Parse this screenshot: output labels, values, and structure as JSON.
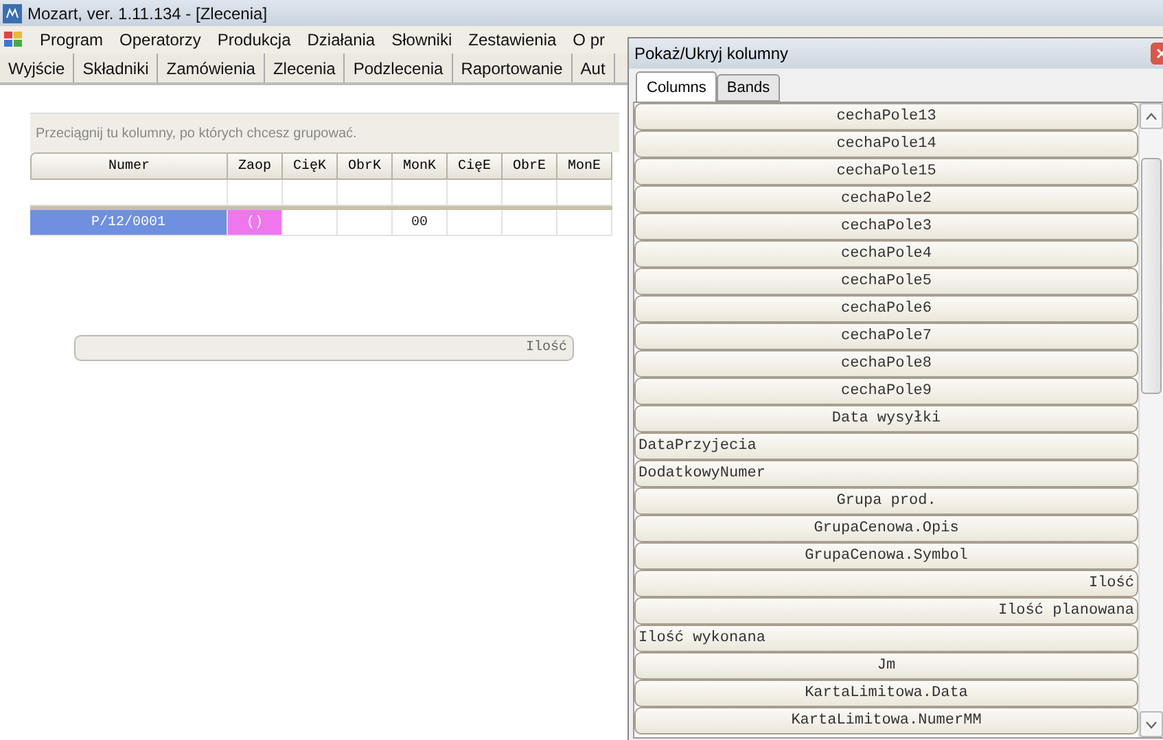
{
  "window": {
    "title": "Mozart, ver. 1.11.134 - [Zlecenia]"
  },
  "menu": [
    "Program",
    "Operatorzy",
    "Produkcja",
    "Działania",
    "Słowniki",
    "Zestawienia",
    "O pr"
  ],
  "toolbar": [
    "Wyjście",
    "Składniki",
    "Zamówienia",
    "Zlecenia",
    "Podzlecenia",
    "Raportowanie",
    "Aut"
  ],
  "grid": {
    "group_hint": "Przeciągnij tu kolumny, po których chcesz grupować.",
    "columns": [
      "Numer",
      "Zaop",
      "CięK",
      "ObrK",
      "MonK",
      "CięE",
      "ObrE",
      "MonE"
    ],
    "rows": [
      {
        "selected": true,
        "cells": [
          {
            "text": "P/12/0001",
            "color": "#6f8fe0"
          },
          {
            "text": "()",
            "color": "#ee77ee"
          },
          {
            "text": ""
          },
          {
            "text": ""
          },
          {
            "text": "00"
          },
          {
            "text": ""
          },
          {
            "text": ""
          },
          {
            "text": ""
          }
        ]
      }
    ],
    "dragged_column": "Ilość"
  },
  "dialog": {
    "title": "Pokaż/Ukryj kolumny",
    "tabs": [
      {
        "label": "Columns",
        "selected": true
      },
      {
        "label": "Bands",
        "selected": false
      }
    ],
    "columns": [
      {
        "label": "cechaPole13",
        "kind": "center"
      },
      {
        "label": "cechaPole14",
        "kind": "center"
      },
      {
        "label": "cechaPole15",
        "kind": "center"
      },
      {
        "label": "cechaPole2",
        "kind": "center"
      },
      {
        "label": "cechaPole3",
        "kind": "center"
      },
      {
        "label": "cechaPole4",
        "kind": "center"
      },
      {
        "label": "cechaPole5",
        "kind": "center"
      },
      {
        "label": "cechaPole6",
        "kind": "center"
      },
      {
        "label": "cechaPole7",
        "kind": "center"
      },
      {
        "label": "cechaPole8",
        "kind": "center"
      },
      {
        "label": "cechaPole9",
        "kind": "center"
      },
      {
        "label": "Data wysyłki",
        "kind": "center"
      },
      {
        "label": "DataPrzyjecia",
        "kind": "left"
      },
      {
        "label": "DodatkowyNumer",
        "kind": "left"
      },
      {
        "label": "Grupa prod.",
        "kind": "center"
      },
      {
        "label": "GrupaCenowa.Opis",
        "kind": "center"
      },
      {
        "label": "GrupaCenowa.Symbol",
        "kind": "center"
      },
      {
        "label": "Ilość",
        "kind": "right"
      },
      {
        "label": "Ilość planowana",
        "kind": "right"
      },
      {
        "label": "Ilość wykonana",
        "kind": "left"
      },
      {
        "label": "Jm",
        "kind": "center"
      },
      {
        "label": "KartaLimitowa.Data",
        "kind": "center"
      },
      {
        "label": "KartaLimitowa.NumerMM",
        "kind": "center"
      }
    ]
  }
}
